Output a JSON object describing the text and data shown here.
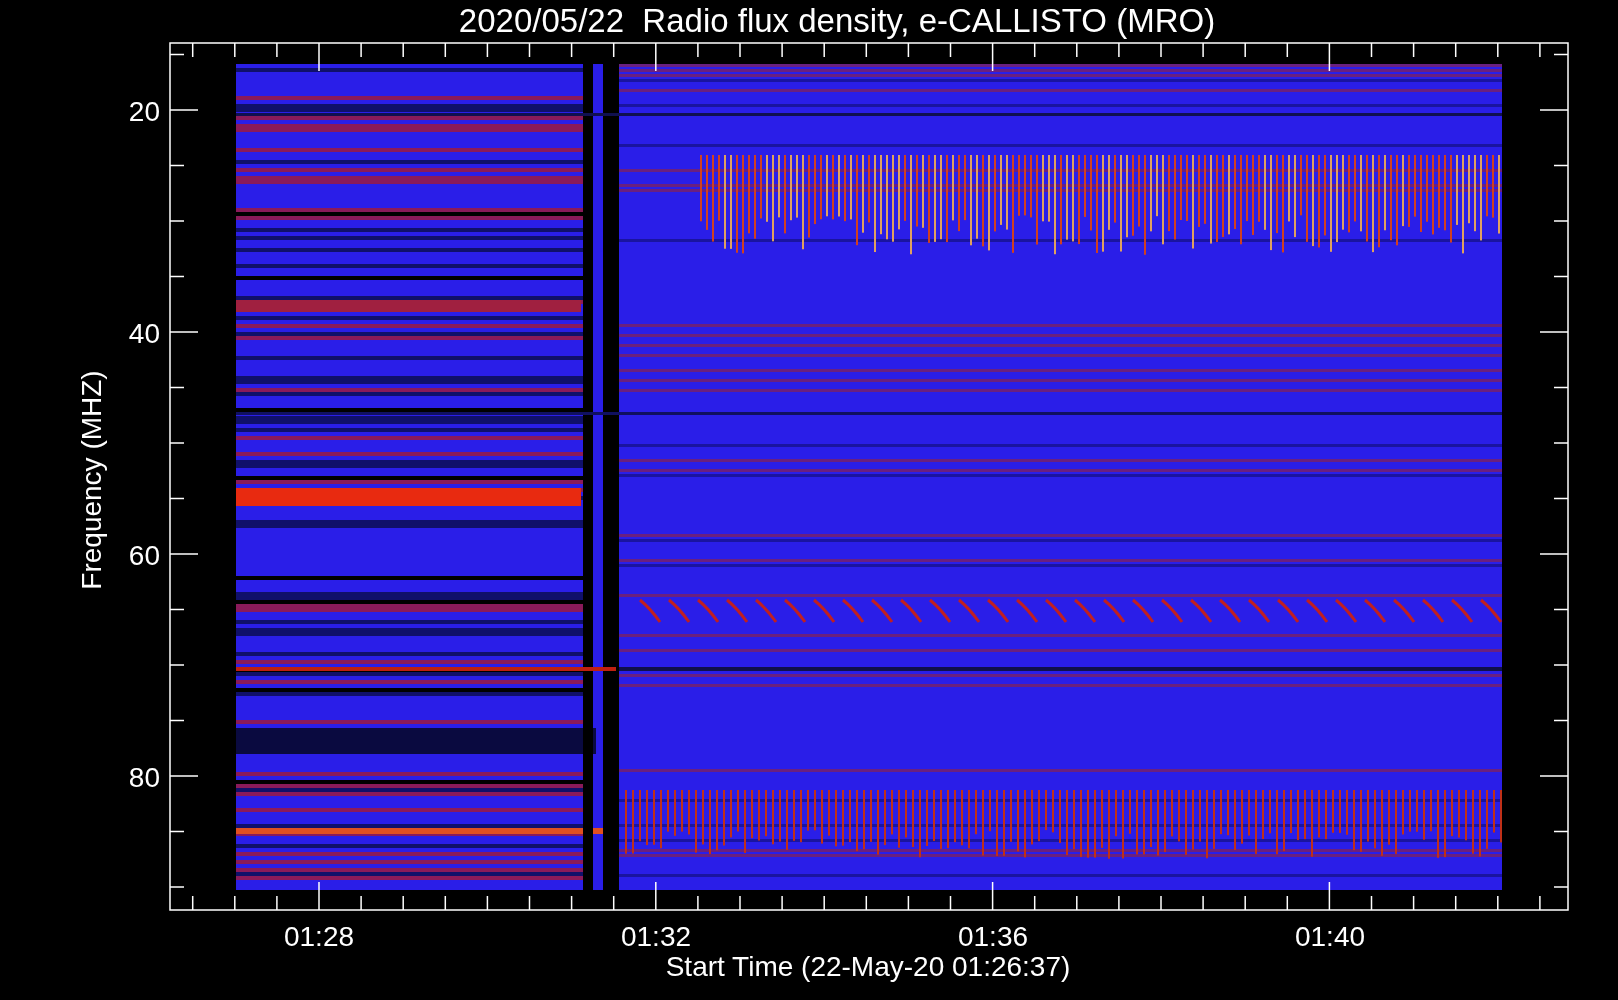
{
  "title": "2020/05/22  Radio flux density, e-CALLISTO (MRO)",
  "y_axis": {
    "label": "Frequency (MHZ)",
    "ticks": [
      "20",
      "40",
      "60",
      "80"
    ]
  },
  "x_axis": {
    "label": "Start Time (22-May-20 01:26:37)",
    "ticks": [
      "01:28",
      "01:32",
      "01:36",
      "01:40"
    ]
  }
}
